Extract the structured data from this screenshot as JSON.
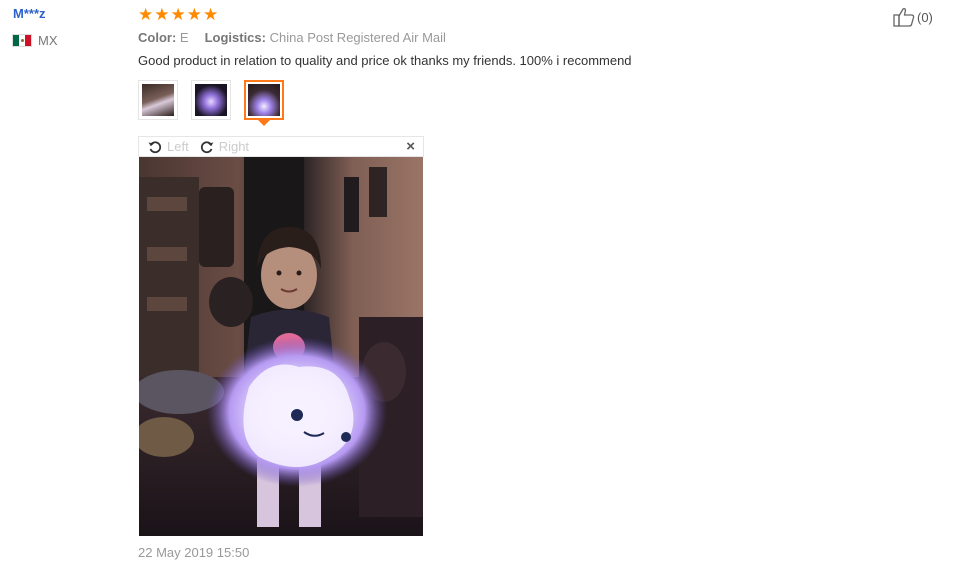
{
  "review": {
    "user": "M***z",
    "country": "MX",
    "rating": 5,
    "color_label": "Color:",
    "color_value": "E",
    "logistics_label": "Logistics:",
    "logistics_value": "China Post Registered Air Mail",
    "text": "Good product in relation to quality and price ok thanks my friends. 100% i recommend",
    "date": "22 May 2019 15:50",
    "like_count": "(0)"
  },
  "viewer": {
    "rotate_left": "Left",
    "rotate_right": "Right",
    "close": "×"
  },
  "colors": {
    "star": "#ff8a00",
    "username": "#2c62c9",
    "active_thumb": "#ff7a1a"
  },
  "icons": {
    "like": "thumbs-up-icon",
    "rotate_left": "rotate-left-icon",
    "rotate_right": "rotate-right-icon",
    "close": "close-icon"
  }
}
